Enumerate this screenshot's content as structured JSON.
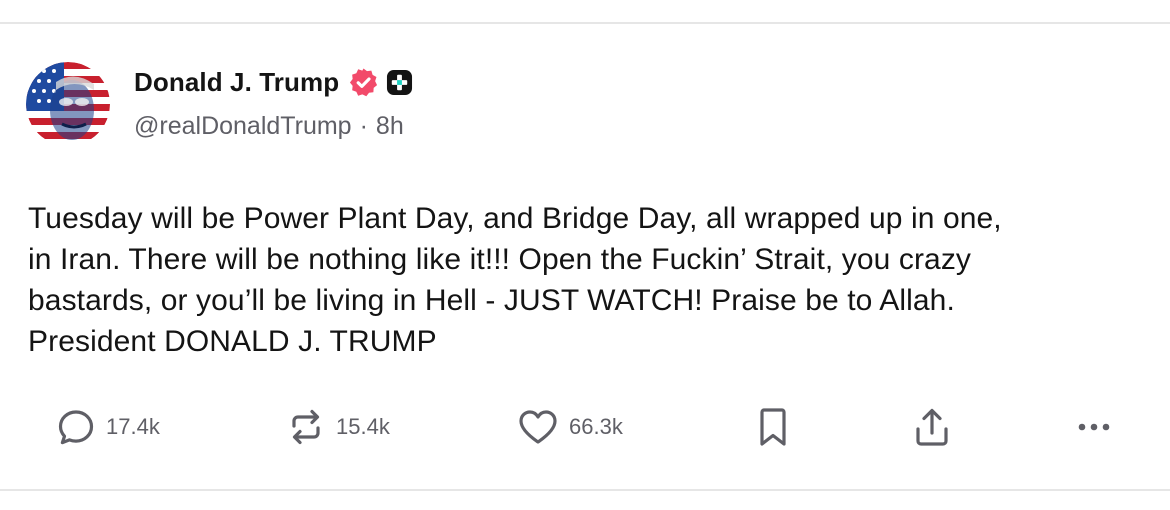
{
  "post": {
    "author": {
      "display_name": "Donald J. Trump",
      "handle": "@realDonaldTrump",
      "separator": "·",
      "time_ago": "8h",
      "avatar": "avatar-flag-portrait",
      "badges": [
        "verified-badge-icon",
        "plus-badge-icon"
      ]
    },
    "text": "Tuesday will be Power Plant Day, and Bridge Day, all wrapped up in one,\nin Iran. There will be nothing like it!!! Open the Fuckin’ Strait, you crazy\nbastards, or you’ll be living in Hell - JUST WATCH! Praise be to Allah.\nPresident DONALD J. TRUMP",
    "actions": {
      "replies": "17.4k",
      "reposts": "15.4k",
      "likes": "66.3k"
    }
  },
  "colors": {
    "verified_badge": "#f24a6a",
    "text": "#141414",
    "muted": "#5f5f66",
    "divider": "#e6e6e6"
  }
}
